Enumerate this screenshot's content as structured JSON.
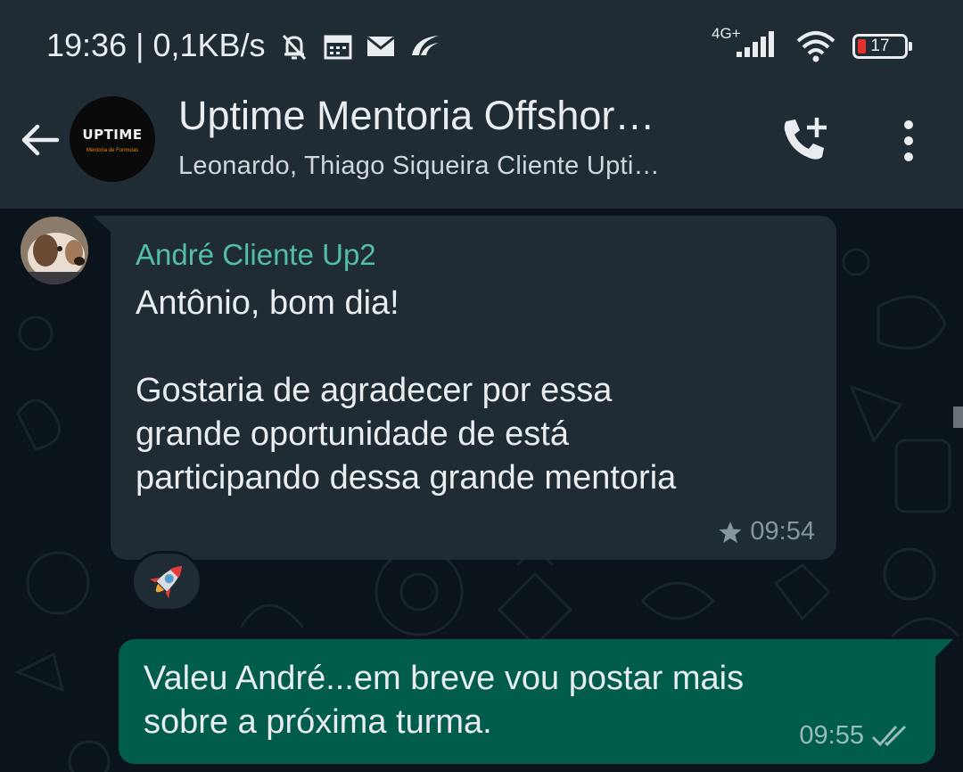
{
  "status_bar": {
    "time": "19:36 | 0,1KB/s",
    "network_type": "4G+",
    "battery_level": "17",
    "icons": [
      "mute-bell-icon",
      "calendar-icon",
      "mail-icon",
      "speed-app-icon",
      "signal-icon",
      "wifi-icon",
      "battery-icon"
    ]
  },
  "header": {
    "title": "Uptime Mentoria Offshor…",
    "subtitle": "Leonardo, Thiago Siqueira Cliente Upti…",
    "avatar_logo": "UPTIME",
    "avatar_logo_sub": "Mentoria de Formulas"
  },
  "messages": [
    {
      "direction": "incoming",
      "sender": "André Cliente Up2",
      "text": "Antônio, bom dia!\n\nGostaria de agradecer por essa\ngrande oportunidade de está\nparticipando dessa grande mentoria",
      "time": "09:54",
      "starred": true,
      "reaction": "🚀"
    },
    {
      "direction": "outgoing",
      "text": "Valeu André...em breve vou postar mais\nsobre a próxima turma.",
      "time": "09:55",
      "status": "read"
    }
  ],
  "colors": {
    "header_bg": "#1f2c33",
    "chat_bg": "#0b141a",
    "incoming_bubble": "#202c33",
    "outgoing_bubble": "#005c4b",
    "sender_name": "#53bdac",
    "meta_text": "#8696a0"
  }
}
